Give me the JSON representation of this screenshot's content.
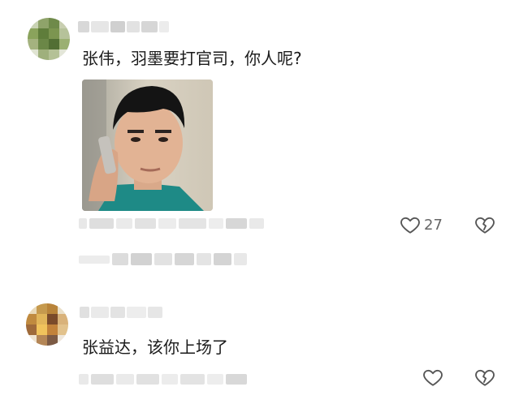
{
  "comments": [
    {
      "text": "张伟，羽墨要打官司，你人呢?",
      "like_count": "27",
      "icons": {
        "like": "heart-outline-icon",
        "dislike": "broken-heart-icon"
      }
    },
    {
      "text": "张益达，该你上场了",
      "icons": {
        "like": "heart-outline-icon",
        "dislike": "broken-heart-icon"
      }
    }
  ],
  "colors": {
    "text": "#1a1a1a",
    "meta": "#666666",
    "icon": "#555555"
  }
}
